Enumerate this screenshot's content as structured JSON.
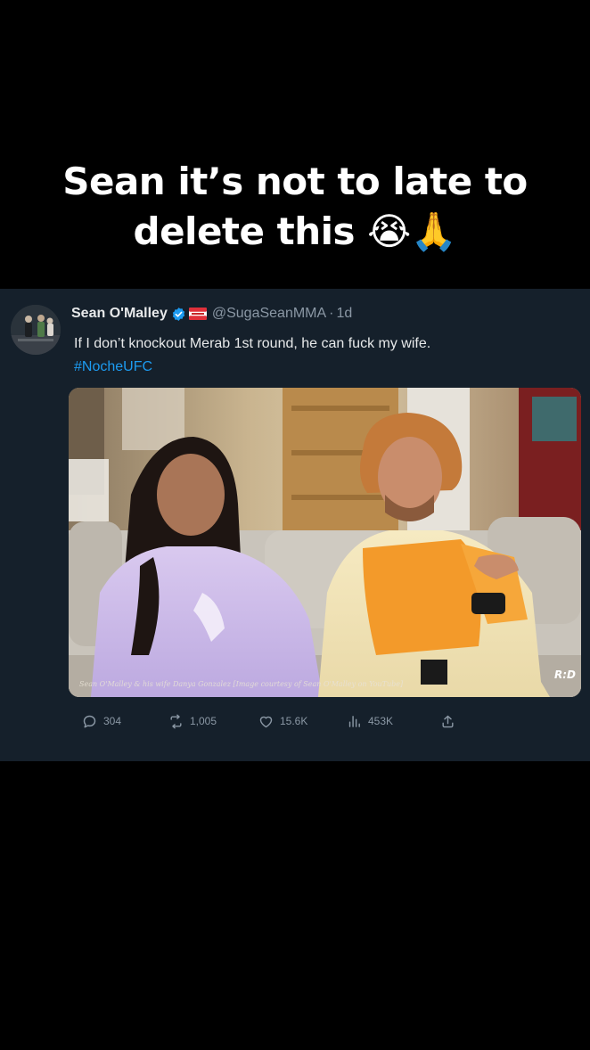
{
  "caption": {
    "line1": "Sean it’s not to late to",
    "line2": "delete this 😭🙏"
  },
  "tweet": {
    "author_name": "Sean O'Malley",
    "handle": "@SugaSeanMMA",
    "separator": "·",
    "time": "1d",
    "text": "If I don’t knockout Merab 1st round, he can fuck my wife.",
    "hashtag": "#NocheUFC",
    "media": {
      "credit": "Sean O'Malley & his wife Danya Gonzalez [Image courtesy of Sean O'Malley on YouTube]",
      "logo": "R:D"
    },
    "actions": {
      "replies": "304",
      "retweets": "1,005",
      "likes": "15.6K",
      "views": "453K"
    }
  },
  "icons": {
    "verified": "verified-badge-icon",
    "flag": "flag-icon",
    "reply": "reply-icon",
    "retweet": "retweet-icon",
    "like": "heart-icon",
    "views": "views-icon",
    "share": "share-icon"
  },
  "colors": {
    "page_background": "#000000",
    "card_background": "#15202b",
    "primary_text": "#e7e9ea",
    "secondary_text": "#8b98a5",
    "link": "#1d9bf0",
    "verified": "#1d9bf0"
  }
}
